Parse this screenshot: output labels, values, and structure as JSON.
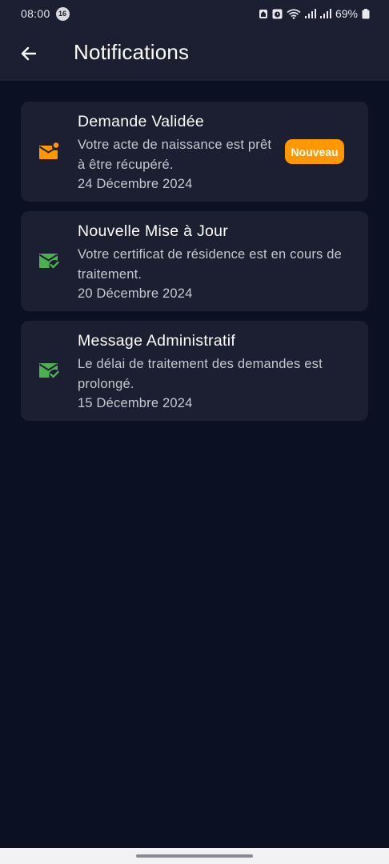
{
  "status_bar": {
    "time": "08:00",
    "notification_count": "16",
    "battery": "69%"
  },
  "header": {
    "title": "Notifications",
    "back_icon": "arrow-left-icon"
  },
  "notifications": [
    {
      "title": "Demande Validée",
      "message": "Votre acte de naissance est prêt à être récupéré.",
      "date": "24 Décembre 2024",
      "badge": "Nouveau",
      "icon": "mark-email-unread-icon",
      "icon_color": "#ff9800"
    },
    {
      "title": "Nouvelle Mise à Jour",
      "message": "Votre certificat de résidence est en cours de traitement.",
      "date": "20 Décembre 2024",
      "icon": "mark-email-read-icon",
      "icon_color": "#4caf50"
    },
    {
      "title": "Message Administratif",
      "message": "Le délai de traitement des demandes est prolongé.",
      "date": "15 Décembre 2024",
      "icon": "mark-email-read-icon",
      "icon_color": "#4caf50"
    }
  ],
  "colors": {
    "background": "#0b1022",
    "surface": "#1c1e31",
    "badge": "#ff9800",
    "read_icon": "#4caf50"
  }
}
